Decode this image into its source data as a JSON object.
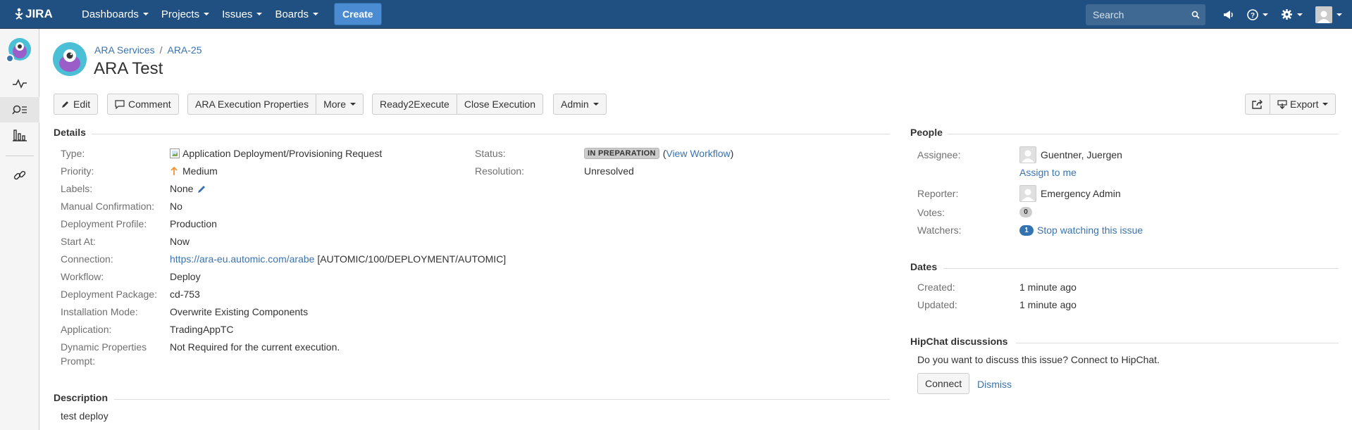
{
  "nav": {
    "logo_text": "JIRA",
    "items": [
      "Dashboards",
      "Projects",
      "Issues",
      "Boards"
    ],
    "create_label": "Create",
    "search_placeholder": "Search"
  },
  "breadcrumb": {
    "project": "ARA Services",
    "issue_key": "ARA-25"
  },
  "issue": {
    "title": "ARA Test"
  },
  "toolbar": {
    "edit": "Edit",
    "comment": "Comment",
    "ara_props": "ARA Execution Properties",
    "more": "More",
    "ready": "Ready2Execute",
    "close": "Close Execution",
    "admin": "Admin",
    "export": "Export"
  },
  "details": {
    "heading": "Details",
    "type_label": "Type:",
    "type_value": "Application Deployment/Provisioning Request",
    "priority_label": "Priority:",
    "priority_value": "Medium",
    "labels_label": "Labels:",
    "labels_value": "None",
    "manual_label": "Manual Confirmation:",
    "manual_value": "No",
    "profile_label": "Deployment Profile:",
    "profile_value": "Production",
    "start_label": "Start At:",
    "start_value": "Now",
    "connection_label": "Connection:",
    "connection_link": "https://ara-eu.automic.com/arabe",
    "connection_suffix": "[AUTOMIC/100/DEPLOYMENT/AUTOMIC]",
    "workflow_label": "Workflow:",
    "workflow_value": "Deploy",
    "package_label": "Deployment Package:",
    "package_value": "cd-753",
    "install_label": "Installation Mode:",
    "install_value": "Overwrite Existing Components",
    "app_label": "Application:",
    "app_value": "TradingAppTC",
    "dyn_label_1": "Dynamic Properties",
    "dyn_label_2": "Prompt:",
    "dyn_value": "Not Required for the current execution.",
    "status_label": "Status:",
    "status_value": "IN PREPARATION",
    "status_link": "View Workflow",
    "resolution_label": "Resolution:",
    "resolution_value": "Unresolved"
  },
  "description": {
    "heading": "Description",
    "text": "test deploy"
  },
  "people": {
    "heading": "People",
    "assignee_label": "Assignee:",
    "assignee_value": "Guentner, Juergen",
    "assign_to_me": "Assign to me",
    "reporter_label": "Reporter:",
    "reporter_value": "Emergency Admin",
    "votes_label": "Votes:",
    "votes_value": "0",
    "watchers_label": "Watchers:",
    "watchers_count": "1",
    "watchers_link": "Stop watching this issue"
  },
  "dates": {
    "heading": "Dates",
    "created_label": "Created:",
    "created_value": "1 minute ago",
    "updated_label": "Updated:",
    "updated_value": "1 minute ago"
  },
  "hipchat": {
    "heading": "HipChat discussions",
    "prompt": "Do you want to discuss this issue? Connect to HipChat.",
    "connect": "Connect",
    "dismiss": "Dismiss"
  },
  "colors": {
    "header_bg": "#205081",
    "link": "#3b73af",
    "priority_medium": "#f79232",
    "watch_badge": "#3572b0"
  }
}
